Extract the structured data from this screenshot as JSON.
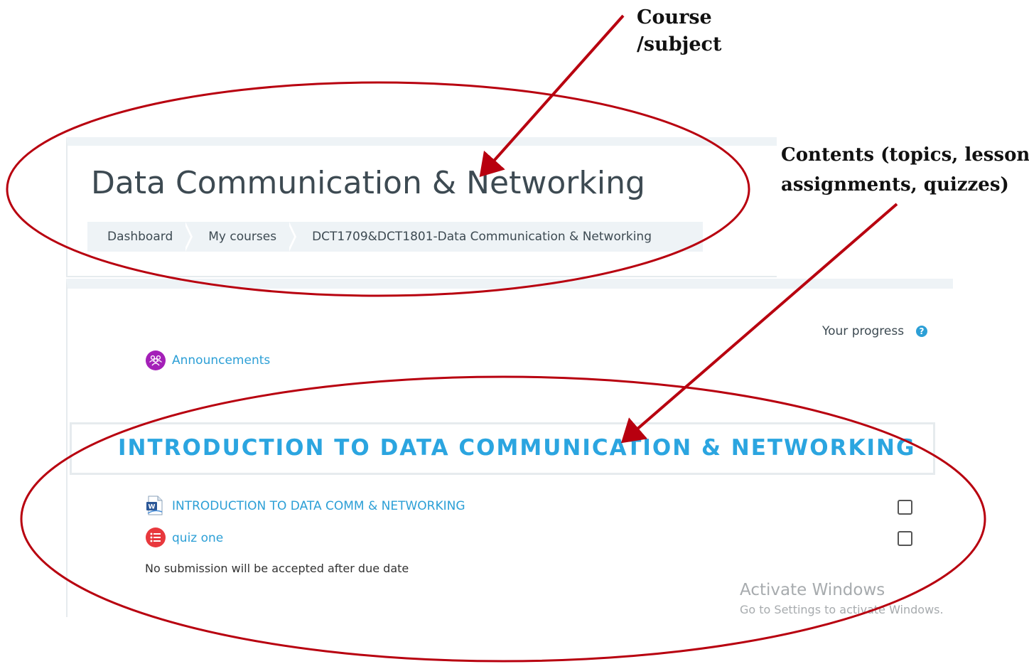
{
  "annotations": {
    "course_callout_line1": "Course",
    "course_callout_line2": "/subject",
    "contents_callout_line1": "Contents (topics, lessons,",
    "contents_callout_line2": "assignments, quizzes)",
    "annotation_color": "#b8000f"
  },
  "course": {
    "title": "Data Communication & Networking",
    "breadcrumb": [
      "Dashboard",
      "My courses",
      "DCT1709&DCT1801-Data Communication & Networking"
    ]
  },
  "progress": {
    "label": "Your progress",
    "help_icon": "?"
  },
  "announcements": {
    "label": "Announcements",
    "icon": "forum-icon"
  },
  "section": {
    "title": "INTRODUCTION TO DATA COMMUNICATION & NETWORKING",
    "activities": [
      {
        "label": "INTRODUCTION TO DATA COMM & NETWORKING",
        "icon": "word-document-icon",
        "completed": false
      },
      {
        "label": "quiz one",
        "icon": "quiz-icon",
        "completed": false
      }
    ],
    "note": "No submission will be accepted after due date"
  },
  "watermark": {
    "line1": "Activate Windows",
    "line2": "Go to Settings to activate Windows."
  },
  "colors": {
    "accent": "#2ba5e0",
    "text": "#3d4a52",
    "forum": "#a420b8",
    "quiz": "#e8383d"
  }
}
